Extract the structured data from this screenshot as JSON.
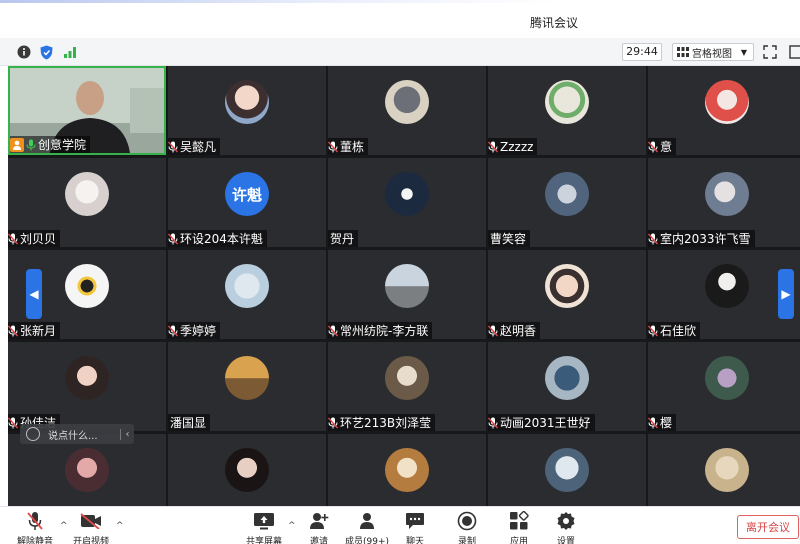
{
  "window": {
    "title": "腾讯会议"
  },
  "infobar": {
    "timer": "29:44",
    "view_mode": "宫格视图"
  },
  "participants": [
    {
      "name": "创意学院",
      "host": true,
      "speaking": true
    },
    {
      "name": "吴懿凡"
    },
    {
      "name": "董栋"
    },
    {
      "name": "Zzzzz"
    },
    {
      "name": "意"
    },
    {
      "name": "刘贝贝"
    },
    {
      "name": "环设204本许魁",
      "avatar_text": "许魁"
    },
    {
      "name": "贺丹"
    },
    {
      "name": "曹笑容"
    },
    {
      "name": "室内2033许飞雪"
    },
    {
      "name": "张新月"
    },
    {
      "name": "季婷婷"
    },
    {
      "name": "常州纺院-李方联"
    },
    {
      "name": "赵明香"
    },
    {
      "name": "石佳欣"
    },
    {
      "name": "孙佳洁"
    },
    {
      "name": "潘国显"
    },
    {
      "name": "环艺213B刘泽莹"
    },
    {
      "name": "动画2031王世好"
    },
    {
      "name": "樱"
    }
  ],
  "chat_hint": "说点什么...",
  "toolbar": {
    "unmute": "解除静音",
    "start_video": "开启视频",
    "share_screen": "共享屏幕",
    "invite": "邀请",
    "members": "成员(99+)",
    "chat": "聊天",
    "record": "录制",
    "apps": "应用",
    "settings": "设置",
    "leave": "离开会议"
  },
  "colors": {
    "accent_blue": "#2b74e5",
    "leave_red": "#d64545",
    "speaking_green": "#36b24a",
    "host_orange": "#f0901e"
  }
}
